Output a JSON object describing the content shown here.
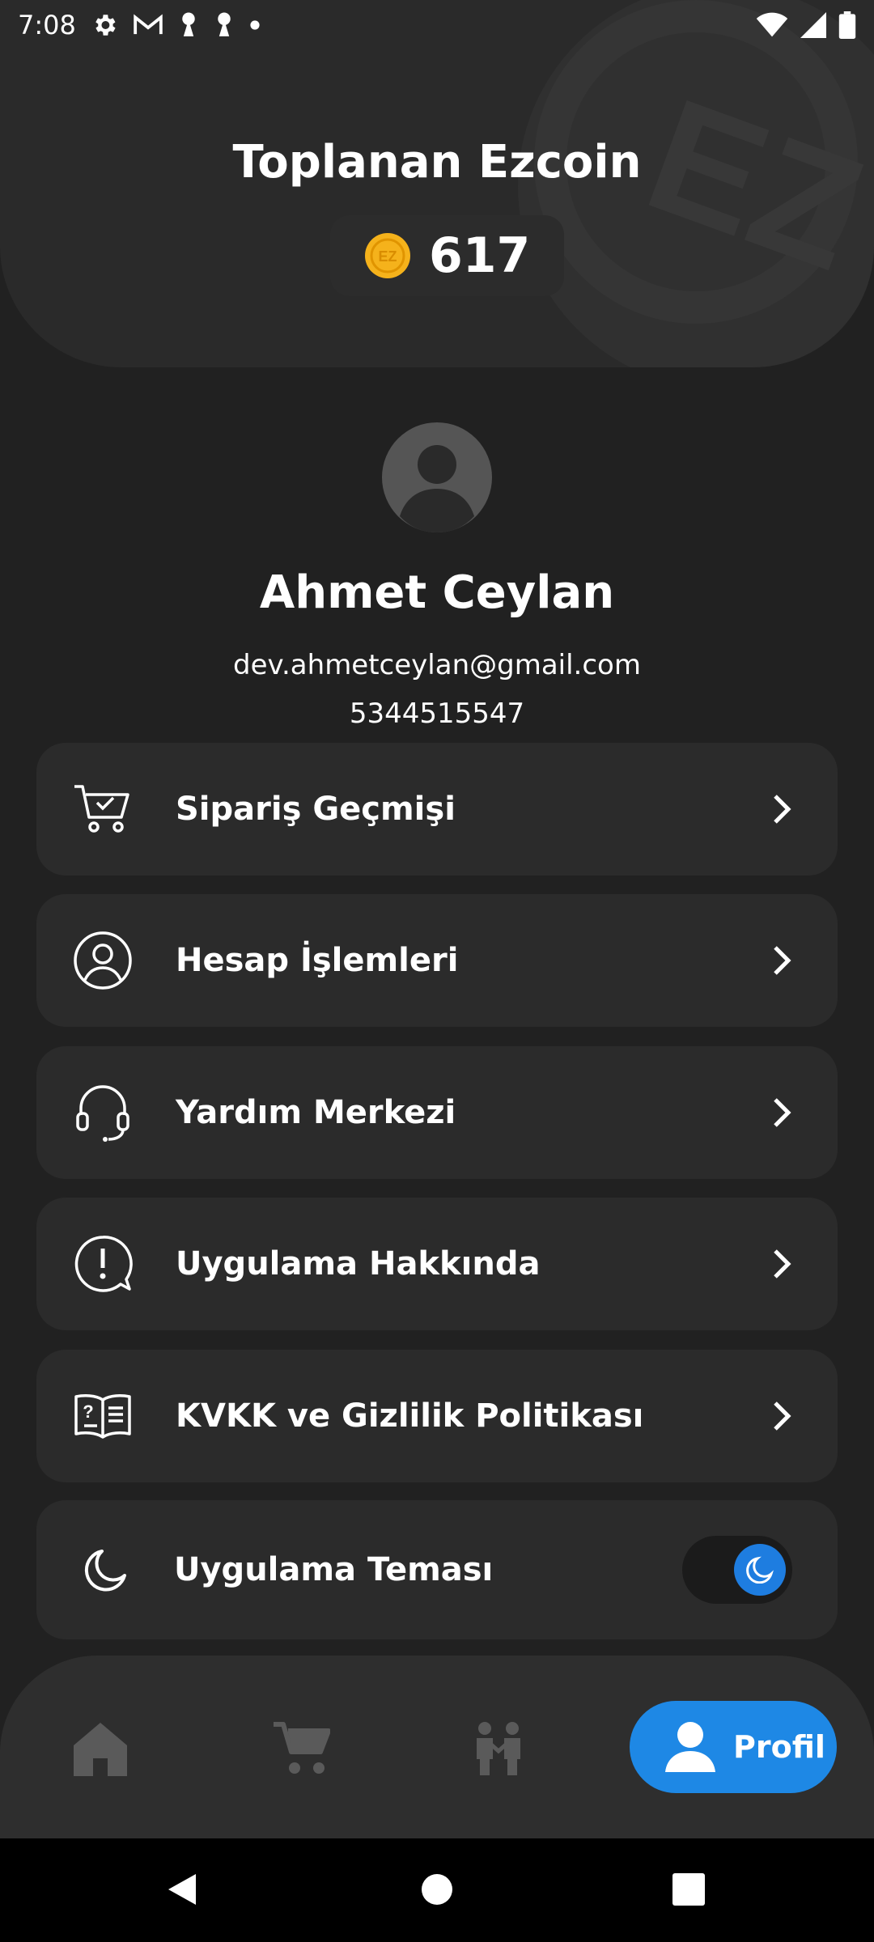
{
  "status_bar": {
    "time": "7:08",
    "left_icons": [
      "settings-icon",
      "gmail-icon",
      "keyhole-icon",
      "keyhole-icon",
      "dot-icon"
    ],
    "right_icons": [
      "wifi-icon",
      "signal-icon",
      "battery-icon"
    ]
  },
  "header": {
    "title": "Toplanan Ezcoin",
    "coin_value": "617",
    "coin_icon_text": "EZ",
    "bg_coin_text": "EZ"
  },
  "profile": {
    "name": "Ahmet Ceylan",
    "email": "dev.ahmetceylan@gmail.com",
    "phone": "5344515547"
  },
  "menu": {
    "items": [
      {
        "label": "Sipariş Geçmişi",
        "icon": "cart-check-icon"
      },
      {
        "label": "Hesap İşlemleri",
        "icon": "user-circle-icon"
      },
      {
        "label": "Yardım Merkezi",
        "icon": "headset-icon"
      },
      {
        "label": "Uygulama Hakkında",
        "icon": "info-chat-icon"
      },
      {
        "label": "KVKK ve Gizlilik Politikası",
        "icon": "book-question-icon"
      }
    ],
    "theme": {
      "label": "Uygulama Teması",
      "dark_mode": true
    }
  },
  "bottom_nav": {
    "items": [
      {
        "icon": "home-icon",
        "active": false
      },
      {
        "icon": "cart-icon",
        "active": false
      },
      {
        "icon": "people-icon",
        "active": false
      },
      {
        "icon": "person-icon",
        "active": true,
        "label": "Profil"
      }
    ]
  },
  "colors": {
    "background": "#212121",
    "card": "#2b2b2b",
    "accent": "#1e88e5",
    "coin": "#f5b21b"
  }
}
